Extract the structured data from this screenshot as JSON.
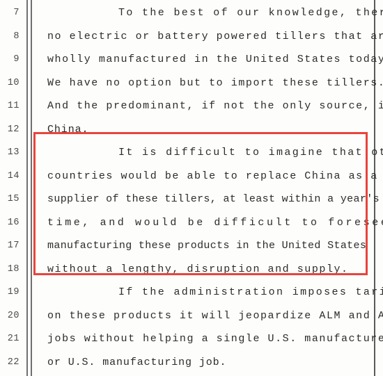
{
  "document": {
    "type": "deposition-transcript-page",
    "background_color": "#fdfdfb",
    "text_color": "#2b2b2b",
    "rule_color": "#6f6f6f",
    "highlight_color": "#e8443c"
  },
  "highlight": {
    "label": "red-box-annotation",
    "covers_lines": "13-18",
    "color": "#e8443c"
  },
  "lines": [
    {
      "number": "7",
      "text": "To the best of our knowledge, there are",
      "indent": true,
      "spacing": "sp-wide",
      "highlighted": false
    },
    {
      "number": "8",
      "text": "no electric or battery powered tillers that are",
      "indent": false,
      "spacing": "sp-mid",
      "highlighted": false
    },
    {
      "number": "9",
      "text": "wholly manufactured in the United States today.",
      "indent": false,
      "spacing": "sp-mid",
      "highlighted": false
    },
    {
      "number": "10",
      "text": "We have no option but to import these tillers.",
      "indent": false,
      "spacing": "sp-mid",
      "highlighted": false
    },
    {
      "number": "11",
      "text": "And the predominant, if not the only source, is",
      "indent": false,
      "spacing": "sp-mid",
      "highlighted": false
    },
    {
      "number": "12",
      "text": "China.",
      "indent": false,
      "spacing": "sp-none",
      "highlighted": false
    },
    {
      "number": "13",
      "text": "It is difficult to imagine that other",
      "indent": true,
      "spacing": "sp-wide",
      "highlighted": true
    },
    {
      "number": "14",
      "text": "countries would be able to replace China as a",
      "indent": false,
      "spacing": "sp-mid",
      "highlighted": true
    },
    {
      "number": "15",
      "text": "supplier of these tillers, at least within a year's",
      "indent": false,
      "spacing": "sp-tight",
      "highlighted": true
    },
    {
      "number": "16",
      "text": "time, and would be difficult to foresee ALM",
      "indent": false,
      "spacing": "sp-xwide",
      "highlighted": true
    },
    {
      "number": "17",
      "text": "manufacturing these products in the United States",
      "indent": false,
      "spacing": "sp-tight",
      "highlighted": true
    },
    {
      "number": "18",
      "text": "without a lengthy, disruption and supply.",
      "indent": false,
      "spacing": "sp-mid",
      "highlighted": true
    },
    {
      "number": "19",
      "text": "If the administration imposes tariffs",
      "indent": true,
      "spacing": "sp-wide",
      "highlighted": false
    },
    {
      "number": "20",
      "text": "on these products it will jeopardize ALM and ALM",
      "indent": false,
      "spacing": "sp-mid",
      "highlighted": false
    },
    {
      "number": "21",
      "text": "jobs without helping a single U.S. manufacturer",
      "indent": false,
      "spacing": "sp-mid",
      "highlighted": false
    },
    {
      "number": "22",
      "text": "or U.S. manufacturing job.",
      "indent": false,
      "spacing": "sp-none",
      "highlighted": false
    }
  ]
}
